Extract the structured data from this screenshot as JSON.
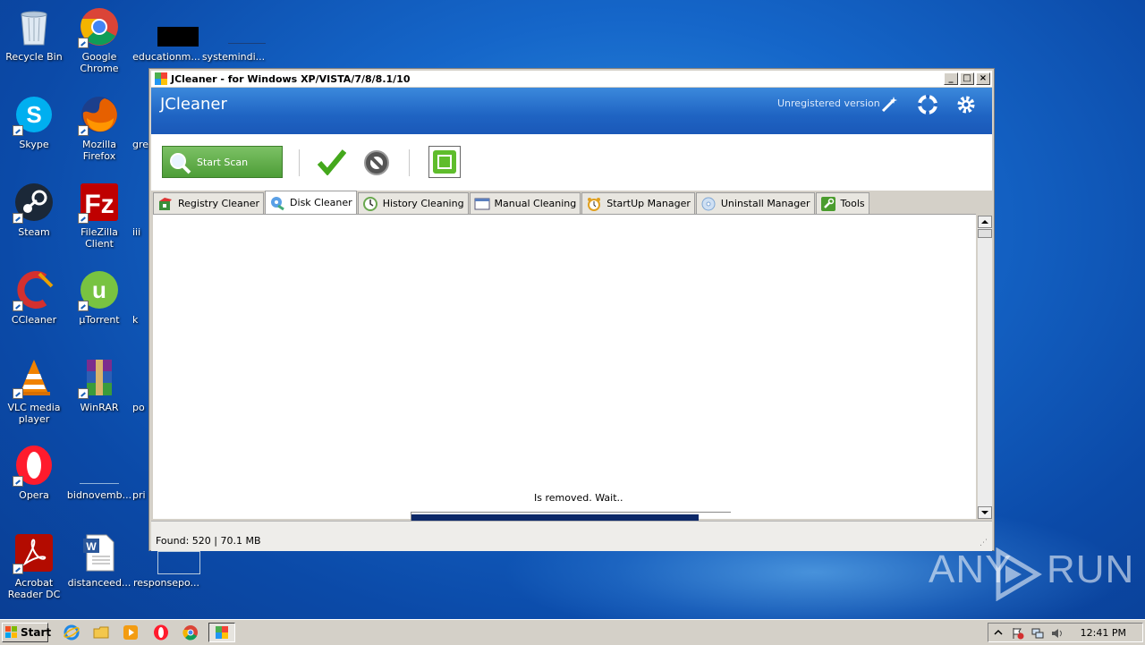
{
  "desktop": {
    "icons": [
      {
        "label": "Recycle Bin"
      },
      {
        "label": "Google Chrome"
      },
      {
        "label": "educationm..."
      },
      {
        "label": "systemindi..."
      },
      {
        "label": "Skype"
      },
      {
        "label": "Mozilla Firefox"
      },
      {
        "label": "gre"
      },
      {
        "label": "Steam"
      },
      {
        "label": "FileZilla Client"
      },
      {
        "label": "iii"
      },
      {
        "label": "CCleaner"
      },
      {
        "label": "µTorrent"
      },
      {
        "label": "k"
      },
      {
        "label": "VLC media player"
      },
      {
        "label": "WinRAR"
      },
      {
        "label": "po"
      },
      {
        "label": "Opera"
      },
      {
        "label": "bidnovemb..."
      },
      {
        "label": "pri"
      },
      {
        "label": "Acrobat Reader DC"
      },
      {
        "label": "distanceed..."
      },
      {
        "label": "responsepo..."
      }
    ]
  },
  "window": {
    "title": "JCleaner - for Windows XP/VISTA/7/8/8.1/10",
    "app_name": "JCleaner",
    "registration": "Unregistered version",
    "controls": {
      "minimize": "_",
      "maximize": "□",
      "close": "×"
    },
    "toolbar": {
      "scan_label": "Start Scan",
      "accept_icon": "checkmark-icon",
      "cancel_icon": "cancel-icon",
      "stop_icon": "stop-icon"
    },
    "tabs": [
      {
        "label": "Registry Cleaner",
        "icon": "registry-icon"
      },
      {
        "label": "Disk Cleaner",
        "icon": "disk-icon",
        "active": true
      },
      {
        "label": "History Cleaning",
        "icon": "clock-icon"
      },
      {
        "label": "Manual Cleaning",
        "icon": "window-icon"
      },
      {
        "label": "StartUp Manager",
        "icon": "alarm-icon"
      },
      {
        "label": "Uninstall Manager",
        "icon": "cd-icon"
      },
      {
        "label": "Tools",
        "icon": "wrench-icon"
      }
    ],
    "content": {
      "message": "Is removed. Wait..",
      "progress": 0.9
    },
    "status": {
      "found": "Found: 520 | 70.1 MB"
    }
  },
  "taskbar": {
    "start_label": "Start",
    "clock": "12:41 PM"
  },
  "watermark": {
    "left": "ANY",
    "right": "RUN"
  },
  "colors": {
    "header_blue": "#2a72cc",
    "progress_fill": "#0c2868",
    "scan_green": "#5eab45"
  }
}
